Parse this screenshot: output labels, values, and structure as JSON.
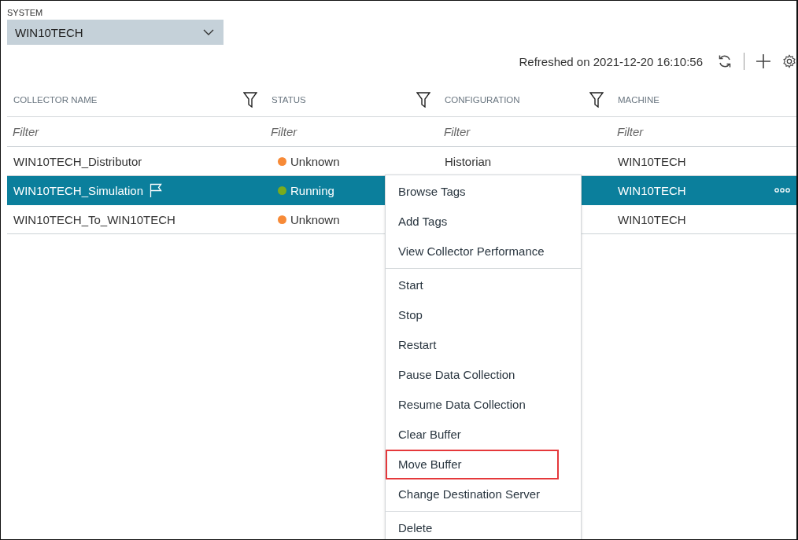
{
  "system": {
    "label": "SYSTEM",
    "value": "WIN10TECH"
  },
  "refreshed": "Refreshed on 2021-12-20 16:10:56",
  "table": {
    "columns": [
      {
        "label": "COLLECTOR NAME",
        "filter_placeholder": "Filter",
        "filterable": true
      },
      {
        "label": "STATUS",
        "filter_placeholder": "Filter",
        "filterable": true
      },
      {
        "label": "CONFIGURATION",
        "filter_placeholder": "Filter",
        "filterable": true
      },
      {
        "label": "MACHINE",
        "filter_placeholder": "Filter",
        "filterable": false
      }
    ],
    "rows": [
      {
        "name": "WIN10TECH_Distributor",
        "flagged": false,
        "status": "Unknown",
        "color": "#f78a37",
        "configuration": "Historian",
        "machine": "WIN10TECH",
        "selected": false
      },
      {
        "name": "WIN10TECH_Simulation",
        "flagged": true,
        "status": "Running",
        "color": "#7aab1e",
        "configuration": "",
        "machine": "WIN10TECH",
        "selected": true
      },
      {
        "name": "WIN10TECH_To_WIN10TECH",
        "flagged": false,
        "status": "Unknown",
        "color": "#f78a37",
        "configuration": "",
        "machine": "WIN10TECH",
        "selected": false
      }
    ]
  },
  "context_menu": {
    "groups": [
      [
        {
          "label": "Browse Tags",
          "highlighted": false
        },
        {
          "label": "Add Tags",
          "highlighted": false
        },
        {
          "label": "View Collector Performance",
          "highlighted": false
        }
      ],
      [
        {
          "label": "Start",
          "highlighted": false
        },
        {
          "label": "Stop",
          "highlighted": false
        },
        {
          "label": "Restart",
          "highlighted": false
        },
        {
          "label": "Pause Data Collection",
          "highlighted": false
        },
        {
          "label": "Resume Data Collection",
          "highlighted": false
        },
        {
          "label": "Clear Buffer",
          "highlighted": false
        },
        {
          "label": "Move Buffer",
          "highlighted": true
        },
        {
          "label": "Change Destination Server",
          "highlighted": false
        }
      ],
      [
        {
          "label": "Delete",
          "highlighted": false
        }
      ]
    ]
  }
}
